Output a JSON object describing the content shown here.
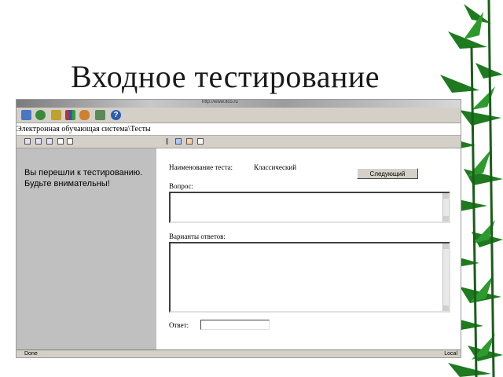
{
  "slide": {
    "title": "Входное тестирование"
  },
  "browser": {
    "address": "http://www.ltco.ru",
    "toolbar_icons": [
      "pointer-icon",
      "globe-icon",
      "home-icon",
      "books-icon",
      "users-icon",
      "tools-icon",
      "help-icon"
    ],
    "help_glyph": "?",
    "breadcrumb": "Электронная обучающая система\\Тесты",
    "status_text": "Done",
    "status_zone": "Local"
  },
  "left": {
    "message_line1": "Вы перешли к тестированию.",
    "message_line2": "Будьте внимательны!"
  },
  "test": {
    "name_label": "Наименование теста:",
    "name_value": "Классический",
    "next_button": "Следующий",
    "question_label": "Вопрос:",
    "question_text": "",
    "variants_label": "Варианты ответов:",
    "variants_text": "",
    "answer_label": "Ответ:",
    "answer_value": ""
  }
}
